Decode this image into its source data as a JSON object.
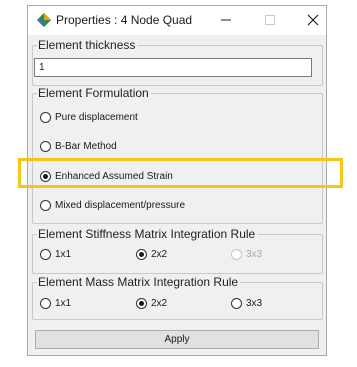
{
  "window": {
    "title": "Properties : 4 Node Quad",
    "controls": [
      "minimize-icon",
      "maximize-icon",
      "close-icon"
    ]
  },
  "thickness": {
    "legend": "Element thickness",
    "value": "1"
  },
  "formulation": {
    "legend": "Element Formulation",
    "options": [
      {
        "label": "Pure displacement",
        "selected": false
      },
      {
        "label": "B-Bar Method",
        "selected": false
      },
      {
        "label": "Enhanced Assumed Strain",
        "selected": true
      },
      {
        "label": "Mixed displacement/pressure",
        "selected": false
      }
    ],
    "highlight_color": "#f5c518"
  },
  "stiffness_rule": {
    "legend": "Element Stiffness Matrix Integration Rule",
    "options": [
      {
        "label": "1x1",
        "selected": false,
        "enabled": true
      },
      {
        "label": "2x2",
        "selected": true,
        "enabled": true
      },
      {
        "label": "3x3",
        "selected": false,
        "enabled": false
      }
    ]
  },
  "mass_rule": {
    "legend": "Element Mass Matrix Integration Rule",
    "options": [
      {
        "label": "1x1",
        "selected": false,
        "enabled": true
      },
      {
        "label": "2x2",
        "selected": true,
        "enabled": true
      },
      {
        "label": "3x3",
        "selected": false,
        "enabled": true
      }
    ]
  },
  "apply_label": "Apply"
}
